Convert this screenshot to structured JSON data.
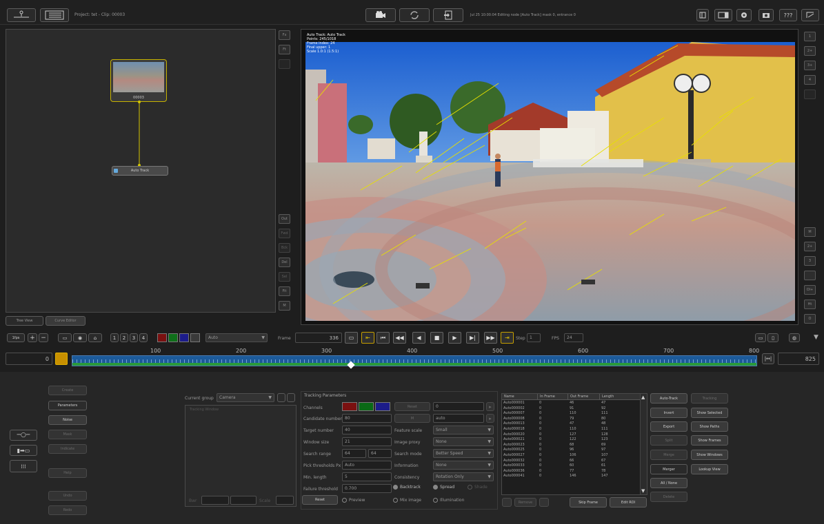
{
  "topbar": {
    "project_label": "Project: tet - Clip: 00003",
    "status": "Jul 25 10:00:04 Editing node [Auto Track] mask  0, entrance  0",
    "help_label": "???"
  },
  "nodes": {
    "clip_node_label": "00003",
    "track_node_label": "Auto Track"
  },
  "left_side_buttons": [
    "Fx",
    "Ft",
    "",
    "Out",
    "Fwd",
    "Bck",
    "Del",
    "Sel",
    "Fit",
    "M"
  ],
  "view_tabs": [
    "Tree View",
    "Curve Editor"
  ],
  "viewer": {
    "overlay_lines": [
      "Auto Track: Auto Track",
      "Points: 245/1018",
      "Frame index: 24",
      "Final upper: 1",
      "Scale 1.0:1 (1.5:1)"
    ]
  },
  "right_side_buttons": [
    "1",
    "2+",
    "3+",
    "4",
    "",
    "M",
    "2+",
    "3",
    "",
    "Ol+",
    "Ht",
    "O"
  ],
  "toolbar": {
    "fps_label": "1fps",
    "channel_select": "Auto",
    "frame_label": "Frame",
    "frame_value": "336",
    "step_label": "Step",
    "step_value": "1",
    "fps_title": "FPS",
    "fps_value": "24"
  },
  "timeline": {
    "start_value": "0",
    "end_value": "825",
    "ticks": [
      "100",
      "200",
      "300",
      "400",
      "500",
      "600",
      "700",
      "800"
    ],
    "current_frame_fraction": 0.407
  },
  "left_menu": {
    "items": [
      "Create",
      "Parameters",
      "Noise",
      "Mask",
      "Indicate",
      "Help",
      "Undo",
      "Redo"
    ]
  },
  "camera_group": {
    "label": "Current group",
    "value": "Camera",
    "placeholder": "Tracking Window",
    "bottom_label1": "Bwr",
    "bottom_label2": "Scale"
  },
  "tracking": {
    "title": "Tracking Parameters",
    "left_labels": [
      "Channels",
      "Candidate number",
      "Target number",
      "Window size",
      "Search range",
      "Pick thresholds Px",
      "Min. length",
      "Failure threshold"
    ],
    "left_values": [
      "",
      "80",
      "40",
      "21",
      "64",
      "Auto",
      "5",
      "0.700"
    ],
    "search_range_second": "64",
    "reset_label": "Reset",
    "reset_value": "0",
    "m_label": "M",
    "m_value": "auto",
    "right_labels": [
      "Feature scale",
      "Image proxy",
      "Search mode",
      "Information",
      "Consistency"
    ],
    "right_values": [
      "Small",
      "None",
      "Better Speed",
      "None",
      "Rotation Only"
    ],
    "backtrack": "Backtrack",
    "spread": "Spread",
    "shade": "Shade",
    "reset_button": "Reset",
    "preview": "Preview",
    "mixed_image": "Mix image",
    "illumination": "Illumination"
  },
  "track_table": {
    "headers": [
      "Name",
      "In Frame",
      "Out Frame",
      "Length"
    ],
    "rows": [
      [
        "Auto000001",
        "0",
        "46",
        "47"
      ],
      [
        "Auto000002",
        "0",
        "91",
        "92"
      ],
      [
        "Auto000007",
        "0",
        "110",
        "111"
      ],
      [
        "Auto000008",
        "0",
        "79",
        "80"
      ],
      [
        "Auto000013",
        "0",
        "47",
        "48"
      ],
      [
        "Auto000018",
        "0",
        "110",
        "111"
      ],
      [
        "Auto000020",
        "0",
        "127",
        "128"
      ],
      [
        "Auto000021",
        "0",
        "122",
        "123"
      ],
      [
        "Auto000023",
        "0",
        "68",
        "69"
      ],
      [
        "Auto000025",
        "0",
        "96",
        "97"
      ],
      [
        "Auto000027",
        "0",
        "106",
        "107"
      ],
      [
        "Auto000032",
        "0",
        "66",
        "67"
      ],
      [
        "Auto000033",
        "0",
        "60",
        "61"
      ],
      [
        "Auto000036",
        "0",
        "77",
        "78"
      ],
      [
        "Auto000041",
        "0",
        "146",
        "147"
      ]
    ],
    "footer_buttons": [
      "",
      "Remove",
      ""
    ]
  },
  "right_actions": {
    "col1": [
      "Auto-Track",
      "Invert",
      "Export",
      "Split",
      "Merge",
      "Merger",
      "All / None",
      "Delete"
    ],
    "col2": [
      "Tracking",
      "Show Selected",
      "Show Paths",
      "Show Frames",
      "Show Windows",
      "Lookup View"
    ],
    "skip_frame": "Skip Frame",
    "edit_roi": "Edit ROI"
  }
}
